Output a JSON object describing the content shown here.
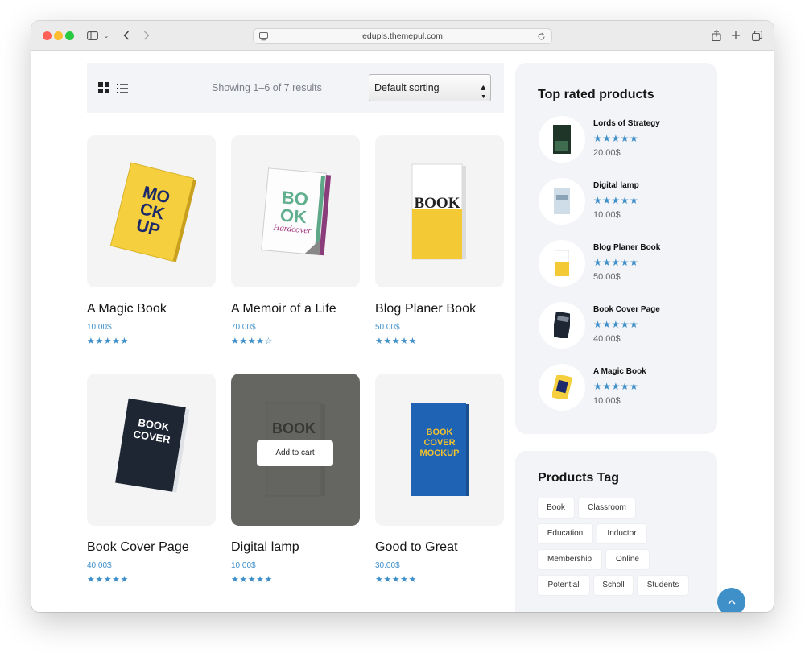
{
  "browser": {
    "url": "edupls.themepul.com"
  },
  "shop": {
    "result_count": "Showing 1–6 of 7 results",
    "sort_selected": "Default sorting",
    "add_to_cart_label": "Add to cart",
    "products": [
      {
        "title": "A Magic Book",
        "price": "10.00$",
        "rating": 5,
        "stars": "★★★★★"
      },
      {
        "title": "A Memoir of a Life",
        "price": "70.00$",
        "rating": 4,
        "stars": "★★★★☆"
      },
      {
        "title": "Blog Planer Book",
        "price": "50.00$",
        "rating": 5,
        "stars": "★★★★★"
      },
      {
        "title": "Book Cover Page",
        "price": "40.00$",
        "rating": 5,
        "stars": "★★★★★"
      },
      {
        "title": "Digital lamp",
        "price": "10.00$",
        "rating": 5,
        "stars": "★★★★★"
      },
      {
        "title": "Good to Great",
        "price": "30.00$",
        "rating": 5,
        "stars": "★★★★★"
      }
    ]
  },
  "sidebar": {
    "top_rated_title": "Top rated products",
    "top_rated": [
      {
        "name": "Lords of Strategy",
        "price": "20.00$",
        "rating": 5,
        "stars": "★★★★★"
      },
      {
        "name": "Digital lamp",
        "price": "10.00$",
        "rating": 5,
        "stars": "★★★★★"
      },
      {
        "name": "Blog Planer Book",
        "price": "50.00$",
        "rating": 5,
        "stars": "★★★★★"
      },
      {
        "name": "Book Cover Page",
        "price": "40.00$",
        "rating": 5,
        "stars": "★★★★★"
      },
      {
        "name": "A Magic Book",
        "price": "10.00$",
        "rating": 5,
        "stars": "★★★★★"
      }
    ],
    "tags_title": "Products Tag",
    "tags": [
      "Book",
      "Classroom",
      "Education",
      "Inductor",
      "Membership",
      "Online",
      "Potential",
      "Scholl",
      "Students"
    ]
  },
  "colors": {
    "accent": "#3f8fc9",
    "panel": "#f3f4f7"
  }
}
